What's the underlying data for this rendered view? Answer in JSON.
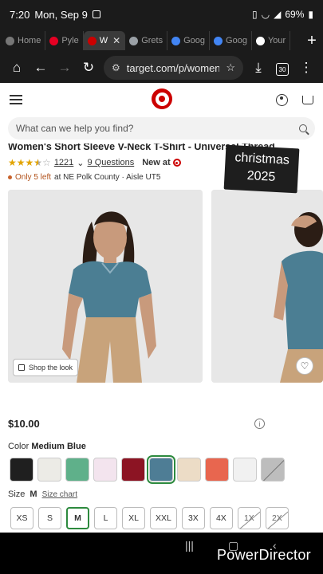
{
  "status_bar": {
    "time": "7:20",
    "date": "Mon, Sep 9",
    "battery": "69%"
  },
  "tabs": [
    {
      "label": "Home",
      "favicon_color": "#777777",
      "active": false
    },
    {
      "label": "Pyle",
      "favicon_color": "#e60023",
      "active": false
    },
    {
      "label": "W",
      "favicon_color": "#cc0000",
      "active": true
    },
    {
      "label": "Grets",
      "favicon_color": "#9aa0a6",
      "active": false
    },
    {
      "label": "Goog",
      "favicon_color": "#4285f4",
      "active": false
    },
    {
      "label": "Goog",
      "favicon_color": "#4285f4",
      "active": false
    },
    {
      "label": "Your",
      "favicon_color": "#ffffff",
      "active": false
    }
  ],
  "toolbar": {
    "url": "target.com/p/women-",
    "tab_count": "30",
    "new_tab": "+"
  },
  "header": {
    "search_placeholder": "What can we help you find?"
  },
  "product": {
    "title": "Women's Short Sleeve V-Neck T-Shirt - Universal Thread",
    "rating_count": "1221",
    "questions": "9 Questions",
    "new_at": "New at",
    "stock_warning": "Only 5 left",
    "stock_location": "at NE Polk County · Aisle UT5",
    "shop_the_look": "Shop the look",
    "price": "$10.00",
    "color_label": "Color",
    "color_value": "Medium Blue",
    "size_label": "Size",
    "size_value": "M",
    "size_chart": "Size chart",
    "rating_stars": 3.5
  },
  "overlay_badge": "christmas 2025",
  "swatches": [
    {
      "color": "#1f1f1f",
      "selected": false,
      "unavailable": false
    },
    {
      "color": "#ecebe6",
      "selected": false,
      "unavailable": false
    },
    {
      "color": "#5fb08a",
      "selected": false,
      "unavailable": false
    },
    {
      "color": "#f3e4ee",
      "selected": false,
      "unavailable": false
    },
    {
      "color": "#8c1423",
      "selected": false,
      "unavailable": false
    },
    {
      "color": "#4e7d95",
      "selected": true,
      "unavailable": false
    },
    {
      "color": "#ecdcc6",
      "selected": false,
      "unavailable": false
    },
    {
      "color": "#e8664f",
      "selected": false,
      "unavailable": false
    },
    {
      "color": "#f1f1f1",
      "selected": false,
      "unavailable": false
    },
    {
      "color": "#bdbdbd",
      "selected": false,
      "unavailable": true
    }
  ],
  "sizes": [
    {
      "label": "XS",
      "selected": false,
      "unavailable": false
    },
    {
      "label": "S",
      "selected": false,
      "unavailable": false
    },
    {
      "label": "M",
      "selected": true,
      "unavailable": false
    },
    {
      "label": "L",
      "selected": false,
      "unavailable": false
    },
    {
      "label": "XL",
      "selected": false,
      "unavailable": false
    },
    {
      "label": "XXL",
      "selected": false,
      "unavailable": false
    },
    {
      "label": "3X",
      "selected": false,
      "unavailable": false
    },
    {
      "label": "4X",
      "selected": false,
      "unavailable": false
    },
    {
      "label": "1X",
      "selected": false,
      "unavailable": true
    },
    {
      "label": "2X",
      "selected": false,
      "unavailable": true
    }
  ],
  "watermark": "PowerDirector",
  "colors": {
    "brand_red": "#cc0000",
    "selected_green": "#2d8a3e",
    "star_gold": "#e2a400"
  }
}
